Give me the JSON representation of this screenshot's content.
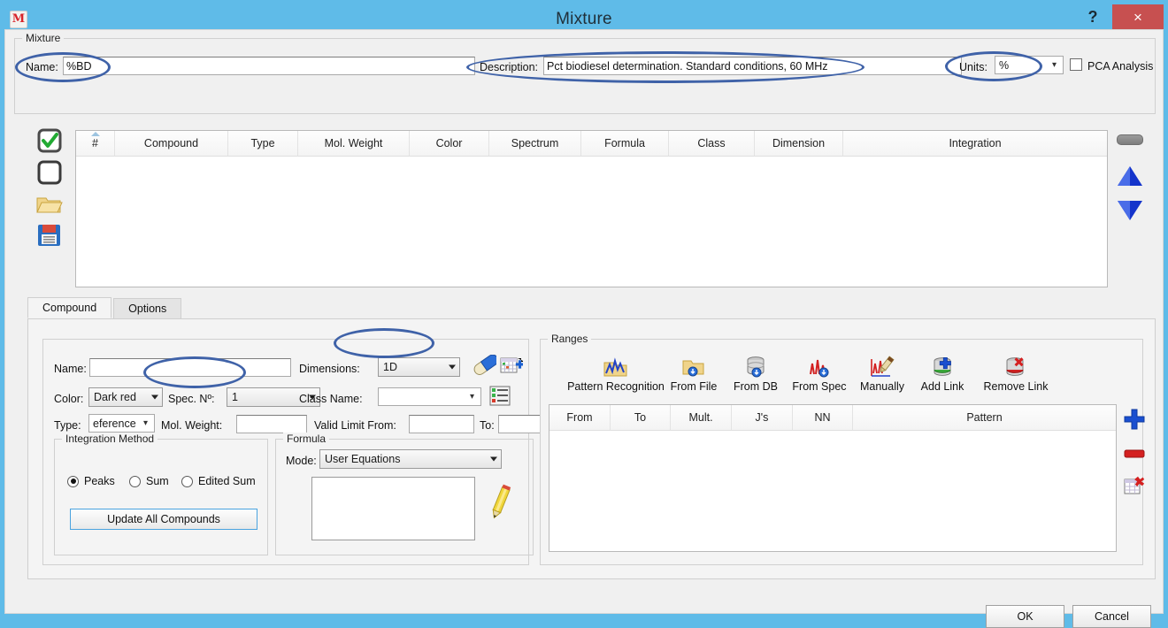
{
  "window": {
    "title": "Mixture",
    "app_icon": "mestrelab-icon",
    "help_label": "?",
    "close_label": "×"
  },
  "mixture_group": {
    "legend": "Mixture",
    "name_label": "Name:",
    "name_value": "%BD",
    "description_label": "Description:",
    "description_value": "Pct biodiesel determination. Standard conditions, 60 MHz",
    "units_label": "Units:",
    "units_value": "%",
    "pca_label": "PCA Analysis",
    "pca_checked": false
  },
  "left_toolbar": {
    "items": [
      {
        "name": "check-all-icon",
        "label": "Check All"
      },
      {
        "name": "uncheck-all-icon",
        "label": "Uncheck All"
      },
      {
        "name": "open-folder-icon",
        "label": "Open"
      },
      {
        "name": "save-floppy-icon",
        "label": "Save"
      }
    ]
  },
  "right_toolbar": {
    "items": [
      {
        "name": "remove-bar-icon",
        "label": "Remove"
      },
      {
        "name": "move-up-icon",
        "label": "Move Up"
      },
      {
        "name": "move-down-icon",
        "label": "Move Down"
      }
    ]
  },
  "compounds_table": {
    "columns": [
      "#",
      "Compound",
      "Type",
      "Mol. Weight",
      "Color",
      "Spectrum",
      "Formula",
      "Class",
      "Dimension",
      "Integration"
    ],
    "rows": [],
    "sort_indicator": "ascending"
  },
  "tabs": [
    {
      "label": "Compound",
      "active": true
    },
    {
      "label": "Options",
      "active": false
    }
  ],
  "compound_panel": {
    "name_label": "Name:",
    "name_value": "",
    "dimensions_label": "Dimensions:",
    "dimensions_value": "1D",
    "color_label": "Color:",
    "color_value": "Dark red",
    "spec_no_label": "Spec. Nº:",
    "spec_no_value": "1",
    "class_name_label": "Class Name:",
    "class_name_value": "",
    "type_label": "Type:",
    "type_value": "eference",
    "mol_weight_label": "Mol. Weight:",
    "mol_weight_value": "",
    "valid_limit_from_label": "Valid Limit From:",
    "valid_limit_from_value": "",
    "valid_limit_to_label": "To:",
    "valid_limit_to_value": "",
    "icons": [
      {
        "name": "pill-capsule-icon"
      },
      {
        "name": "add-table-icon"
      },
      {
        "name": "class-list-icon"
      }
    ],
    "integration_group": {
      "legend": "Integration Method",
      "options": [
        {
          "label": "Peaks",
          "selected": true
        },
        {
          "label": "Sum",
          "selected": false
        },
        {
          "label": "Edited Sum",
          "selected": false
        }
      ],
      "update_button": "Update All Compounds"
    },
    "formula_group": {
      "legend": "Formula",
      "mode_label": "Mode:",
      "mode_value": "User Equations",
      "editor_value": "",
      "edit_icon": "pencil-edit-icon"
    }
  },
  "ranges_panel": {
    "legend": "Ranges",
    "toolbar": [
      {
        "label": "Pattern Recognition",
        "icon": "pattern-recognition-icon"
      },
      {
        "label": "From File",
        "icon": "from-file-icon"
      },
      {
        "label": "From DB",
        "icon": "from-db-icon"
      },
      {
        "label": "From Spec",
        "icon": "from-spec-icon"
      },
      {
        "label": "Manually",
        "icon": "manually-icon"
      },
      {
        "label": "Add Link",
        "icon": "add-link-icon"
      },
      {
        "label": "Remove Link",
        "icon": "remove-link-icon"
      }
    ],
    "columns": [
      "From",
      "To",
      "Mult.",
      "J's",
      "NN",
      "Pattern"
    ],
    "rows": [],
    "side_buttons": [
      {
        "name": "add-range-icon",
        "label": "Add"
      },
      {
        "name": "remove-range-icon",
        "label": "Remove"
      },
      {
        "name": "clear-ranges-icon",
        "label": "Clear"
      }
    ]
  },
  "footer": {
    "ok_label": "OK",
    "cancel_label": "Cancel"
  },
  "colors": {
    "titlebar": "#5fbbe8",
    "close_button": "#c75050",
    "highlight_ellipse": "#3f62a8",
    "panel_bg": "#f0f0f0"
  }
}
